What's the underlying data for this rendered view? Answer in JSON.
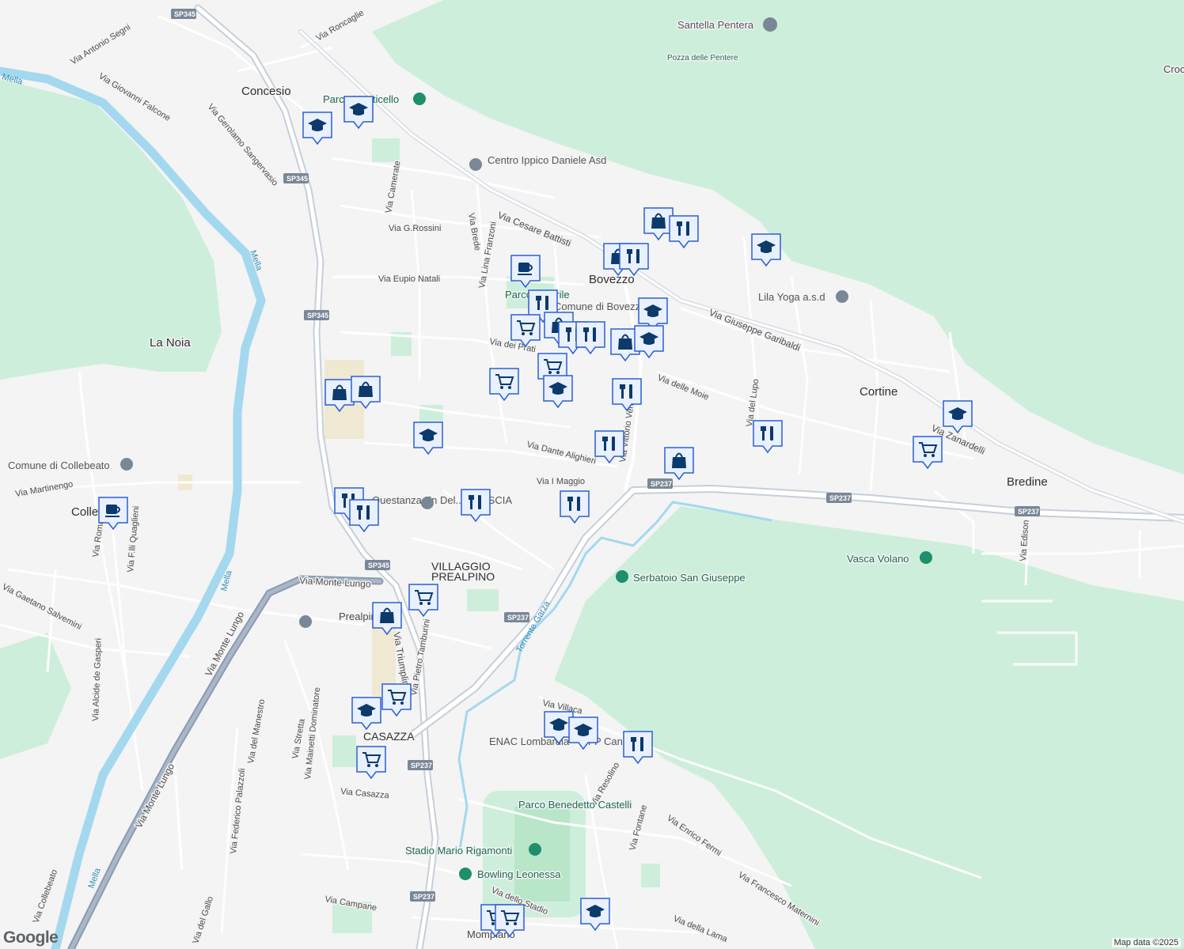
{
  "map": {
    "places": [
      "Concesio",
      "La Noia",
      "Bovezzo",
      "Cortine",
      "Bredine",
      "CASAZZA",
      "Collebeato",
      "VILLAGGIO",
      "PREALPINO",
      "Prealpino",
      "Mompiano",
      "Croce"
    ],
    "streets": [
      "Via Roncaglie",
      "Via Antonio Segni",
      "Via Giovanni Falcone",
      "Via Gerolamo Sangervasio",
      "Via Camerate",
      "Via G.Rossini",
      "Via Eupio Natali",
      "Via Brede",
      "Via Lina Franzoni",
      "Via Cesare Battisti",
      "Via Giuseppe Garibaldi",
      "Via del Lupo",
      "Via delle Moie",
      "Via dei Prati",
      "Via Vittorio Veneto",
      "Via Dante Alighieri",
      "Via I Maggio",
      "Via Zanardelli",
      "Via Martinengo",
      "Via Roma",
      "Via F.lli Quaglieni",
      "Via Gaetano Salvemini",
      "Via Alcide de Gasperi",
      "Via Monte Lungo",
      "Via Triumplina",
      "Via Pietro Tamburini",
      "Via Stretta",
      "Via Mainetti Dominatore",
      "Via del Manestro",
      "Via Federico Palazzoli",
      "Via Casazza",
      "Via Villaca",
      "Via Resolino",
      "Via Fontane",
      "Via Enrico Fermi",
      "Via Francesco Maternini",
      "Via Campane",
      "Via dello Stadio",
      "Via della Lama",
      "Via del Gallo",
      "Via Collebeato",
      "Via Edison"
    ],
    "roads": [
      "SP345",
      "SP237"
    ],
    "water": [
      "Mella",
      "Torrente Garza"
    ],
    "pois": [
      "Santella Pentera",
      "Pozza delle Pentere",
      "Parco Monticello",
      "Centro Ippico Daniele Asd",
      "Parco Castrile",
      "Comune di Bovezzo",
      "Lila Yoga a.s.d",
      "Comune di Collebeato",
      "Serbatoio San Giuseppe",
      "Vasca Volano",
      "ENAC Lombardia – CFP Canossa",
      "Parco Benedetto Castelli",
      "Stadio Mario Rigamonti",
      "Bowling Leonessa",
      "Questanza En Del... BRESCIA"
    ],
    "marker_counts": {
      "restaurant": 14,
      "shopping": 8,
      "grocery": 8,
      "school": 13,
      "cafe": 2
    }
  },
  "footer": {
    "logo": "Google",
    "attribution": "Map data ©2025"
  },
  "colors": {
    "background": "#f4f4f4",
    "park": "#cdeedb",
    "water": "#a3d8ef",
    "highway": "#8a9bb1",
    "marker_bg": "#e9f0ff",
    "marker_border": "#2c5fd1",
    "marker_icon": "#0b3a6b"
  }
}
